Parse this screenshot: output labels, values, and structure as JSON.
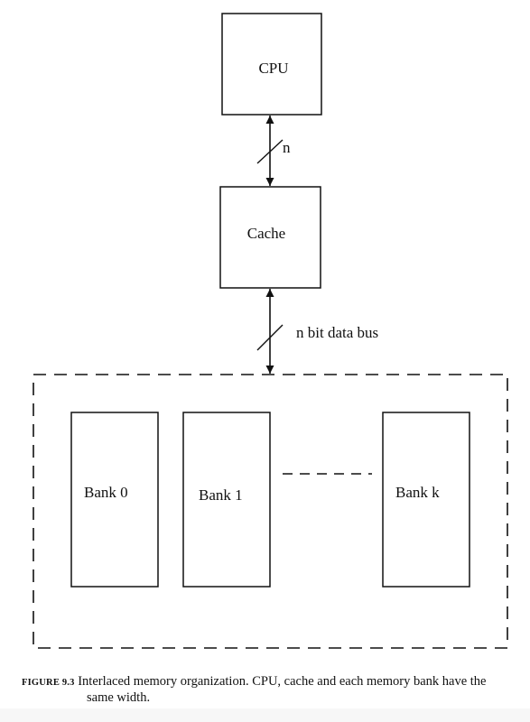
{
  "diagram": {
    "nodes": {
      "cpu": {
        "label": "CPU"
      },
      "cache": {
        "label": "Cache"
      },
      "banks": [
        {
          "label": "Bank 0"
        },
        {
          "label": "Bank 1"
        },
        {
          "label": "Bank k"
        }
      ]
    },
    "connections": {
      "cpu_cache": {
        "label": "n",
        "type": "bidirectional-bus"
      },
      "cache_memory": {
        "label": "n bit data bus",
        "type": "bidirectional-bus"
      }
    },
    "memory_group": {
      "style": "dashed",
      "ellipsis": "dashed-line"
    }
  },
  "caption": {
    "figure_number": "FIGURE 9.3",
    "text_line1": "Interlaced memory organization. CPU, cache and each memory bank have the",
    "text_line2": "same width."
  }
}
